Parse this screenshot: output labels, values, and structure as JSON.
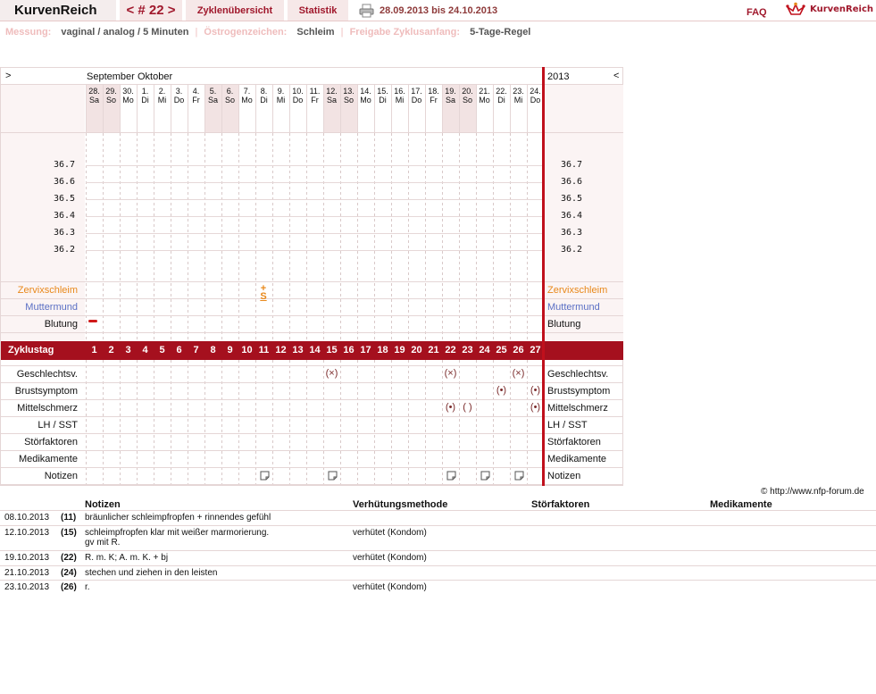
{
  "topbar": {
    "brand": "KurvenReich",
    "cycle": "< # 22 >",
    "overview": "Zyklenübersicht",
    "stats": "Statistik",
    "daterange": "28.09.2013 bis 24.10.2013",
    "faq": "FAQ",
    "logo": "KurvenReich"
  },
  "settings": {
    "measurement_label": "Messung:",
    "measurement_value": "vaginal / analog / 5 Minuten",
    "estrogen_label": "Östrogenzeichen:",
    "estrogen_value": "Schleim",
    "release_label": "Freigabe Zyklusanfang:",
    "release_value": "5-Tage-Regel"
  },
  "chart": {
    "nav_left": ">",
    "nav_right": "<",
    "months": [
      "September",
      "Oktober"
    ],
    "year": "2013",
    "days": [
      {
        "num": "28.",
        "dow": "Sa",
        "weekend": true
      },
      {
        "num": "29.",
        "dow": "So",
        "weekend": true
      },
      {
        "num": "30.",
        "dow": "Mo",
        "weekend": false
      },
      {
        "num": "1.",
        "dow": "Di",
        "weekend": false
      },
      {
        "num": "2.",
        "dow": "Mi",
        "weekend": false
      },
      {
        "num": "3.",
        "dow": "Do",
        "weekend": false
      },
      {
        "num": "4.",
        "dow": "Fr",
        "weekend": false
      },
      {
        "num": "5.",
        "dow": "Sa",
        "weekend": true
      },
      {
        "num": "6.",
        "dow": "So",
        "weekend": true
      },
      {
        "num": "7.",
        "dow": "Mo",
        "weekend": false
      },
      {
        "num": "8.",
        "dow": "Di",
        "weekend": false
      },
      {
        "num": "9.",
        "dow": "Mi",
        "weekend": false
      },
      {
        "num": "10.",
        "dow": "Do",
        "weekend": false
      },
      {
        "num": "11.",
        "dow": "Fr",
        "weekend": false
      },
      {
        "num": "12.",
        "dow": "Sa",
        "weekend": true
      },
      {
        "num": "13.",
        "dow": "So",
        "weekend": true
      },
      {
        "num": "14.",
        "dow": "Mo",
        "weekend": false
      },
      {
        "num": "15.",
        "dow": "Di",
        "weekend": false
      },
      {
        "num": "16.",
        "dow": "Mi",
        "weekend": false
      },
      {
        "num": "17.",
        "dow": "Do",
        "weekend": false
      },
      {
        "num": "18.",
        "dow": "Fr",
        "weekend": false
      },
      {
        "num": "19.",
        "dow": "Sa",
        "weekend": true
      },
      {
        "num": "20.",
        "dow": "So",
        "weekend": true
      },
      {
        "num": "21.",
        "dow": "Mo",
        "weekend": false
      },
      {
        "num": "22.",
        "dow": "Di",
        "weekend": false
      },
      {
        "num": "23.",
        "dow": "Mi",
        "weekend": false
      },
      {
        "num": "24.",
        "dow": "Do",
        "weekend": false
      }
    ],
    "temperatures": [
      "36.7",
      "36.6",
      "36.5",
      "36.4",
      "36.3",
      "36.2"
    ],
    "rows_top": [
      {
        "label": "Zervixschleim",
        "color": "orange"
      },
      {
        "label": "Muttermund",
        "color": "blue"
      },
      {
        "label": "Blutung",
        "color": "black"
      }
    ],
    "cycleday_label": "Zyklustag",
    "cycledays": [
      "1",
      "2",
      "3",
      "4",
      "5",
      "6",
      "7",
      "8",
      "9",
      "10",
      "11",
      "12",
      "13",
      "14",
      "15",
      "16",
      "17",
      "18",
      "19",
      "20",
      "21",
      "22",
      "23",
      "24",
      "25",
      "26",
      "27"
    ],
    "rows_bottom": [
      "Geschlechtsv.",
      "Brustsymptom",
      "Mittelschmerz",
      "LH / SST",
      "Störfaktoren",
      "Medikamente",
      "Notizen"
    ],
    "mucus_mark": "+\nS",
    "intercourse_days": [
      15,
      22,
      26
    ],
    "intercourse_mark": "(×)",
    "breast_days": [
      25,
      27
    ],
    "breast_mark": "(•)",
    "midpain": [
      {
        "day": 22,
        "mark": "(•)"
      },
      {
        "day": 23,
        "mark": "( )"
      },
      {
        "day": 27,
        "mark": "(•)"
      }
    ],
    "note_days": [
      11,
      15,
      22,
      24,
      26
    ]
  },
  "copyright": "© http://www.nfp-forum.de",
  "notes_table": {
    "headers": [
      "Notizen",
      "Verhütungsmethode",
      "Störfaktoren",
      "Medikamente"
    ],
    "rows": [
      {
        "date": "08.10.2013",
        "cd": "(11)",
        "note": "bräunlicher schleimpfropfen + rinnendes gefühl",
        "method": ""
      },
      {
        "date": "12.10.2013",
        "cd": "(15)",
        "note": "schleimpfropfen klar mit weißer marmorierung.",
        "note2": "gv mit R.",
        "method": "verhütet (Kondom)"
      },
      {
        "date": "19.10.2013",
        "cd": "(22)",
        "note": "R. m. K; A. m. K. + bj",
        "method": "verhütet (Kondom)"
      },
      {
        "date": "21.10.2013",
        "cd": "(24)",
        "note": "stechen und ziehen in den leisten",
        "method": ""
      },
      {
        "date": "23.10.2013",
        "cd": "(26)",
        "note": "r.",
        "method": "verhütet (Kondom)"
      }
    ]
  }
}
